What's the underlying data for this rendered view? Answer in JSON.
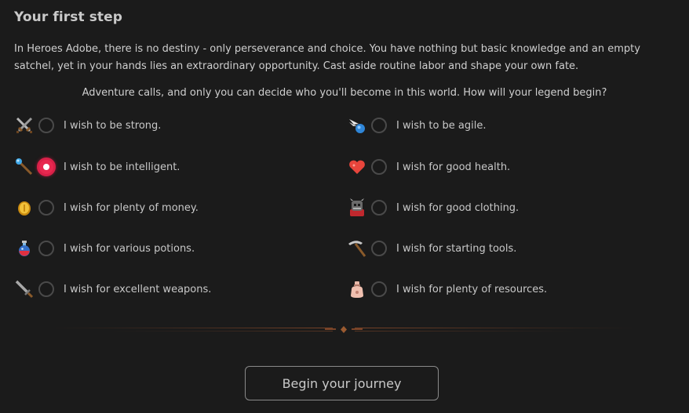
{
  "header": {
    "title": "Your first step"
  },
  "intro_text": "In Heroes Adobe, there is no destiny - only perseverance and choice. You have nothing but basic knowledge and an empty satchel, yet in your hands lies an extraordinary opportunity. Cast aside routine labor and shape your own fate.",
  "prompt_text": "Adventure calls, and only you can decide who you'll become in this world. How will your legend begin?",
  "options": [
    {
      "label": "I wish to be strong.",
      "icon": "crossed-swords-icon",
      "selected": false
    },
    {
      "label": "I wish to be agile.",
      "icon": "winged-boot-icon",
      "selected": false
    },
    {
      "label": "I wish to be intelligent.",
      "icon": "magic-wand-icon",
      "selected": true
    },
    {
      "label": "I wish for good health.",
      "icon": "heart-icon",
      "selected": false
    },
    {
      "label": "I wish for plenty of money.",
      "icon": "gold-coin-icon",
      "selected": false
    },
    {
      "label": "I wish for good clothing.",
      "icon": "armor-icon",
      "selected": false
    },
    {
      "label": "I wish for various potions.",
      "icon": "potion-icon",
      "selected": false
    },
    {
      "label": "I wish for starting tools.",
      "icon": "pickaxe-icon",
      "selected": false
    },
    {
      "label": "I wish for excellent weapons.",
      "icon": "sword-icon",
      "selected": false
    },
    {
      "label": "I wish for plenty of resources.",
      "icon": "resource-sack-icon",
      "selected": false
    }
  ],
  "begin_button_label": "Begin your journey",
  "colors": {
    "background": "#1b1b1b",
    "accent_selected": "#e8284f",
    "divider": "#5a3220"
  }
}
